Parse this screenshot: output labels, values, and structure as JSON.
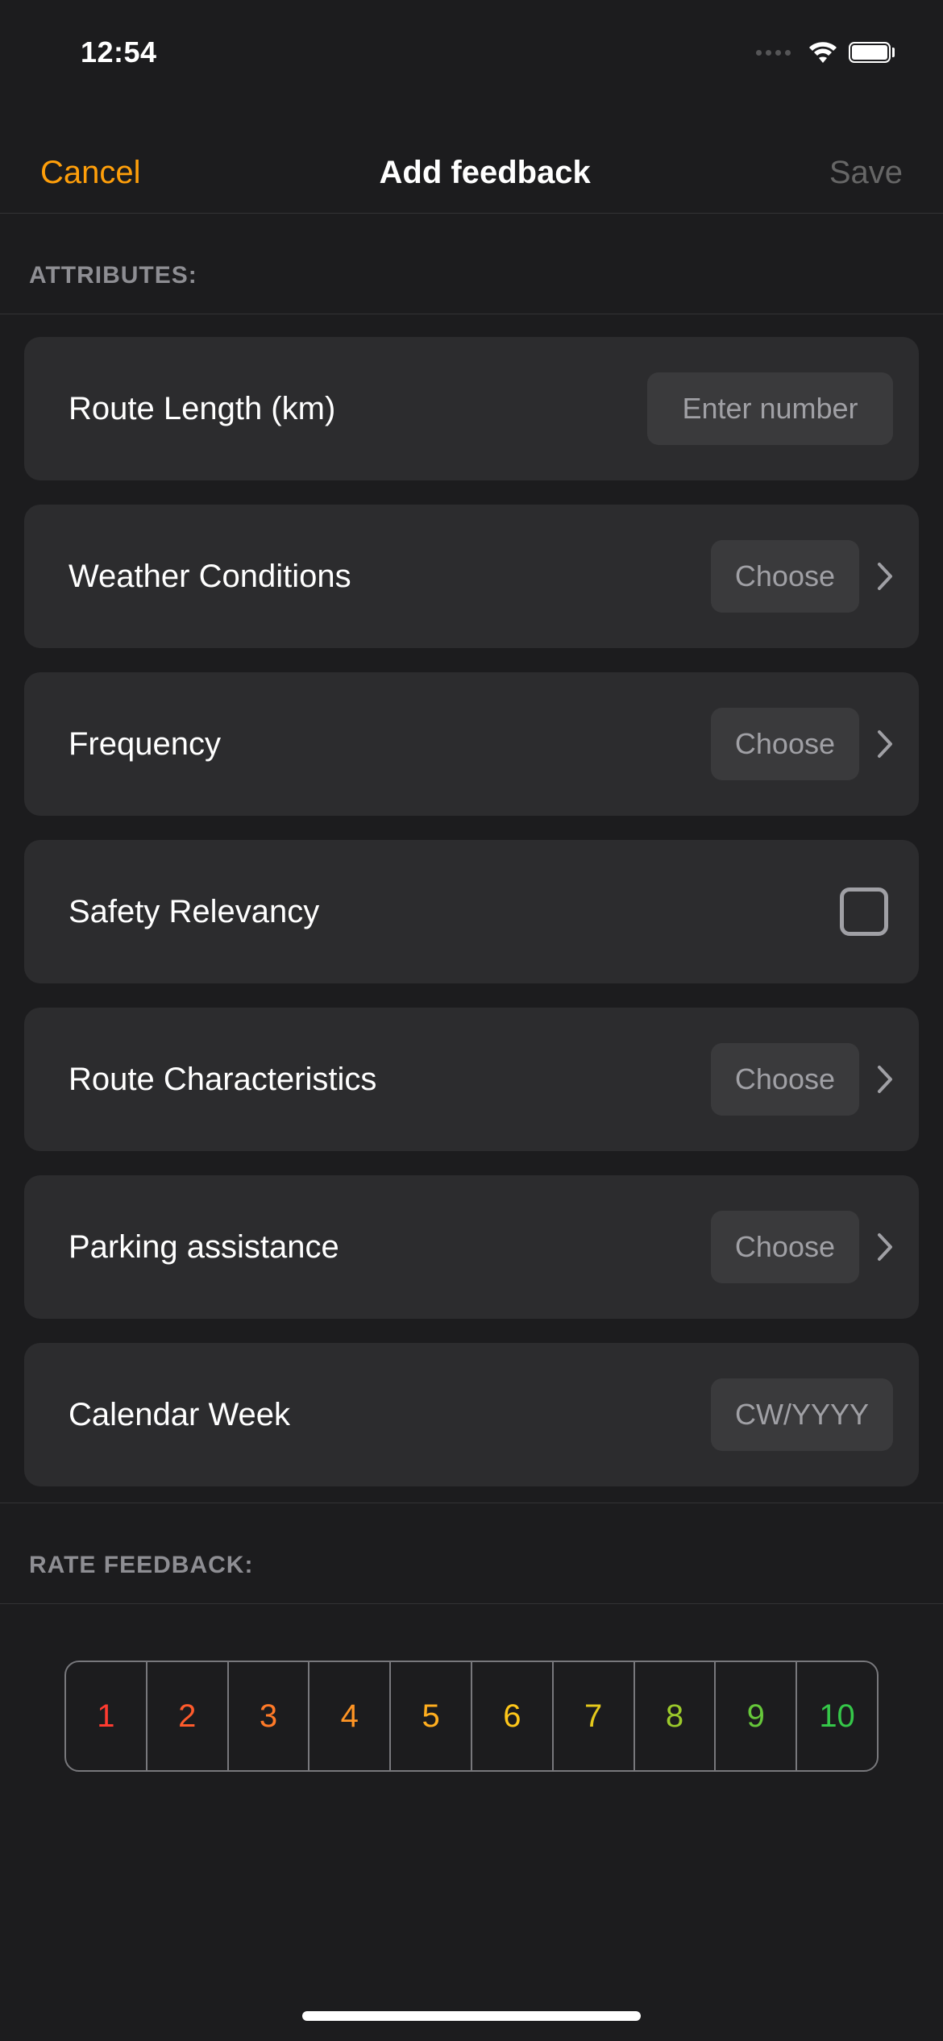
{
  "status": {
    "time": "12:54"
  },
  "nav": {
    "cancel": "Cancel",
    "title": "Add feedback",
    "save": "Save"
  },
  "sections": {
    "attributes_header": "Attributes:",
    "rate_header": "Rate feedback:"
  },
  "attributes": {
    "route_length": {
      "label": "Route Length (km)",
      "placeholder": "Enter number",
      "value": ""
    },
    "weather": {
      "label": "Weather Conditions",
      "button": "Choose",
      "value": ""
    },
    "frequency": {
      "label": "Frequency",
      "button": "Choose",
      "value": ""
    },
    "safety": {
      "label": "Safety Relevancy",
      "checked": false
    },
    "route_char": {
      "label": "Route Characteristics",
      "button": "Choose",
      "value": ""
    },
    "parking": {
      "label": "Parking assistance",
      "button": "Choose",
      "value": ""
    },
    "calendar_week": {
      "label": "Calendar Week",
      "placeholder": "CW/YYYY",
      "value": ""
    }
  },
  "rating": {
    "options": [
      "1",
      "2",
      "3",
      "4",
      "5",
      "6",
      "7",
      "8",
      "9",
      "10"
    ],
    "selected": null
  }
}
